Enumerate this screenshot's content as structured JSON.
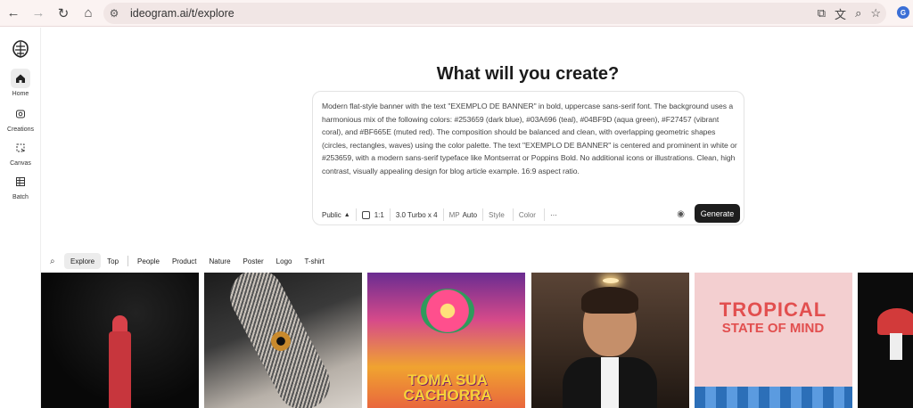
{
  "browser": {
    "url": "ideogram.ai/t/explore"
  },
  "sidebar": {
    "items": [
      {
        "label": "Home",
        "icon": "home-icon"
      },
      {
        "label": "Creations",
        "icon": "creations-icon"
      },
      {
        "label": "Canvas",
        "icon": "canvas-icon"
      },
      {
        "label": "Batch",
        "icon": "batch-icon"
      }
    ]
  },
  "main": {
    "title": "What will you create?",
    "prompt": {
      "text": "Modern flat-style banner with the text \"EXEMPLO DE BANNER\" in bold, uppercase sans-serif font. The background uses a harmonious mix of the following colors: #253659 (dark blue), #03A696 (teal), #04BF9D (aqua green), #F27457 (vibrant coral), and #BF665E (muted red). The composition should be balanced and clean, with overlapping geometric shapes (circles, rectangles, waves) using the color palette. The text \"EXEMPLO DE BANNER\" is centered and prominent in white or #253659, with a modern sans-serif typeface like Montserrat or Poppins Bold. No additional icons or illustrations. Clean, high contrast, visually appealing design for blog article example. 16:9 aspect ratio."
    },
    "toolbar": {
      "visibility": "Public",
      "aspect": "1:1",
      "model": "3.0 Turbo x 4",
      "mp_label": "MP",
      "mp_value": "Auto",
      "style": "Style",
      "color": "Color",
      "more": "···",
      "generate": "Generate"
    }
  },
  "filters": [
    "Explore",
    "Top",
    "People",
    "Product",
    "Nature",
    "Poster",
    "Logo",
    "T-shirt"
  ],
  "gallery": {
    "card3_text": "TOMA SUA CACHORRA",
    "card5_line1": "TROPICAL",
    "card5_line2": "STATE OF MIND"
  }
}
